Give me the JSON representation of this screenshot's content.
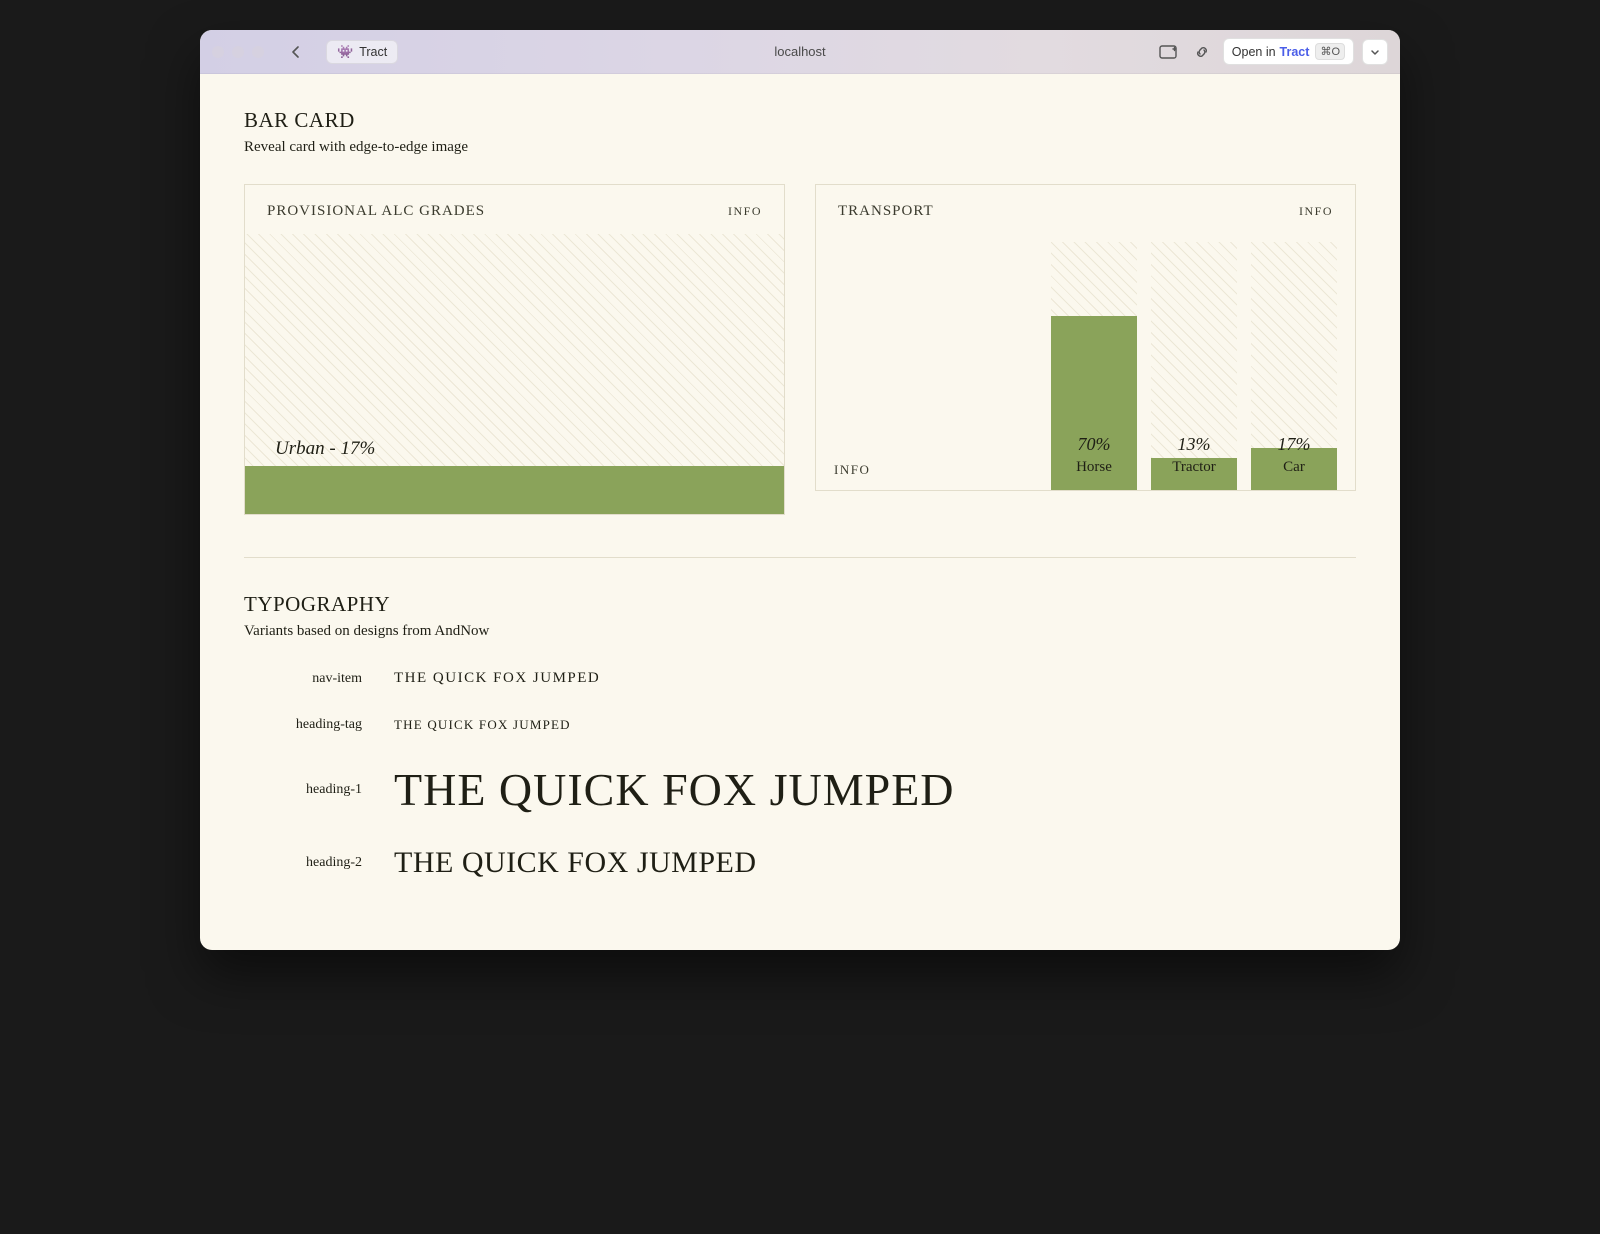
{
  "titlebar": {
    "tab_name": "Tract",
    "url": "localhost",
    "open_prefix": "Open in",
    "open_app": "Tract",
    "shortcut": "⌘O"
  },
  "section_barcard": {
    "title": "BAR CARD",
    "subtitle": "Reveal card with edge-to-edge image"
  },
  "card_alc": {
    "title": "PROVISIONAL ALC GRADES",
    "info": "INFO",
    "bar_label": "Urban - 17%"
  },
  "card_transport": {
    "title": "TRANSPORT",
    "info_top": "INFO",
    "info_bottom": "INFO",
    "bars": [
      {
        "pct": "70%",
        "name": "Horse"
      },
      {
        "pct": "13%",
        "name": "Tractor"
      },
      {
        "pct": "17%",
        "name": "Car"
      }
    ]
  },
  "section_typo": {
    "title": "TYPOGRAPHY",
    "subtitle": "Variants based on designs from AndNow",
    "rows": [
      {
        "label": "nav-item",
        "sample": "THE QUICK FOX JUMPED",
        "cls": "s-nav"
      },
      {
        "label": "heading-tag",
        "sample": "THE QUICK FOX JUMPED",
        "cls": "s-tag"
      },
      {
        "label": "heading-1",
        "sample": "THE QUICK FOX JUMPED",
        "cls": "s-h1"
      },
      {
        "label": "heading-2",
        "sample": "THE QUICK FOX JUMPED",
        "cls": "s-h2"
      }
    ]
  },
  "chart_data": [
    {
      "type": "bar",
      "title": "PROVISIONAL ALC GRADES",
      "categories": [
        "Urban"
      ],
      "values": [
        17
      ],
      "ylim": [
        0,
        100
      ],
      "ylabel": "%"
    },
    {
      "type": "bar",
      "title": "TRANSPORT",
      "categories": [
        "Horse",
        "Tractor",
        "Car"
      ],
      "values": [
        70,
        13,
        17
      ],
      "ylim": [
        0,
        100
      ],
      "ylabel": "%"
    }
  ],
  "colors": {
    "accent": "#8aa35a",
    "paper": "#fbf8ee"
  }
}
